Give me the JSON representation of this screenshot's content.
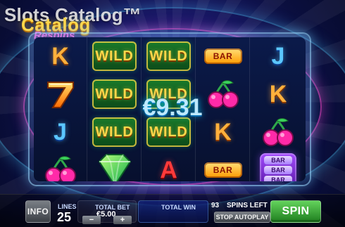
{
  "watermark": "Slots Catalog™",
  "logo": {
    "line1": "Catalog",
    "line2": "Respins"
  },
  "win": {
    "amount": "€9.31"
  },
  "reels": [
    [
      "K",
      "7",
      "J",
      "cherries"
    ],
    [
      "WILD",
      "WILD",
      "WILD",
      "diamond"
    ],
    [
      "WILD",
      "WILD",
      "WILD",
      "A"
    ],
    [
      "BAR",
      "cherries",
      "K",
      "BAR"
    ],
    [
      "J",
      "K",
      "cherries",
      "multi-bar"
    ]
  ],
  "ui": {
    "info_label": "INFO",
    "lines_label": "LINES",
    "lines_value": "25",
    "total_bet_label": "TOTAL BET",
    "total_bet_value": "€5.00",
    "minus": "−",
    "plus": "+",
    "total_win_label": "TOTAL WIN",
    "spins_left_value": "93",
    "spins_left_label": "SPINS LEFT",
    "stop_autoplay_label": "STOP AUTOPLAY",
    "spin_label": "SPIN"
  },
  "symbols": {
    "wild": "WILD",
    "bar": "BAR",
    "mini_bar": "BAR"
  }
}
